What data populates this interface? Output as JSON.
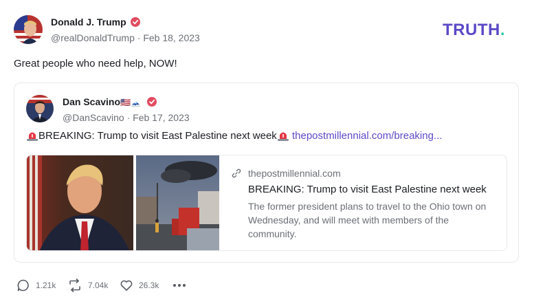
{
  "post": {
    "author_name": "Donald J. Trump",
    "handle": "@realDonaldTrump",
    "date": "Feb 18, 2023",
    "separator": " · ",
    "text": "Great people who need help, NOW!"
  },
  "brand": {
    "logo_text": "TRUTH",
    "logo_dot": ".",
    "colors": {
      "logo": "#5b4ac7",
      "logo_dot": "#2cc8a0",
      "verified": "#e14b5f",
      "link": "#5b4ac7"
    }
  },
  "quote": {
    "author_name": "Dan Scavino",
    "author_emoji": "🇺🇸🗻",
    "handle": "@DanScavino",
    "date": "Feb 17, 2023",
    "separator": " · ",
    "text": "BREAKING: Trump to visit East Palestine next week",
    "link_text": "thepostmillennial.com/breaking...",
    "link_card": {
      "domain": "thepostmillennial.com",
      "title": "BREAKING: Trump to visit East Palestine next week",
      "description": "The former president plans to travel to the Ohio town on Wednesday, and will meet with members of the community."
    }
  },
  "actions": {
    "replies": "1.21k",
    "reposts": "7.04k",
    "likes": "26.3k",
    "icons": [
      "reply-icon",
      "repost-icon",
      "like-icon",
      "more-icon"
    ]
  }
}
